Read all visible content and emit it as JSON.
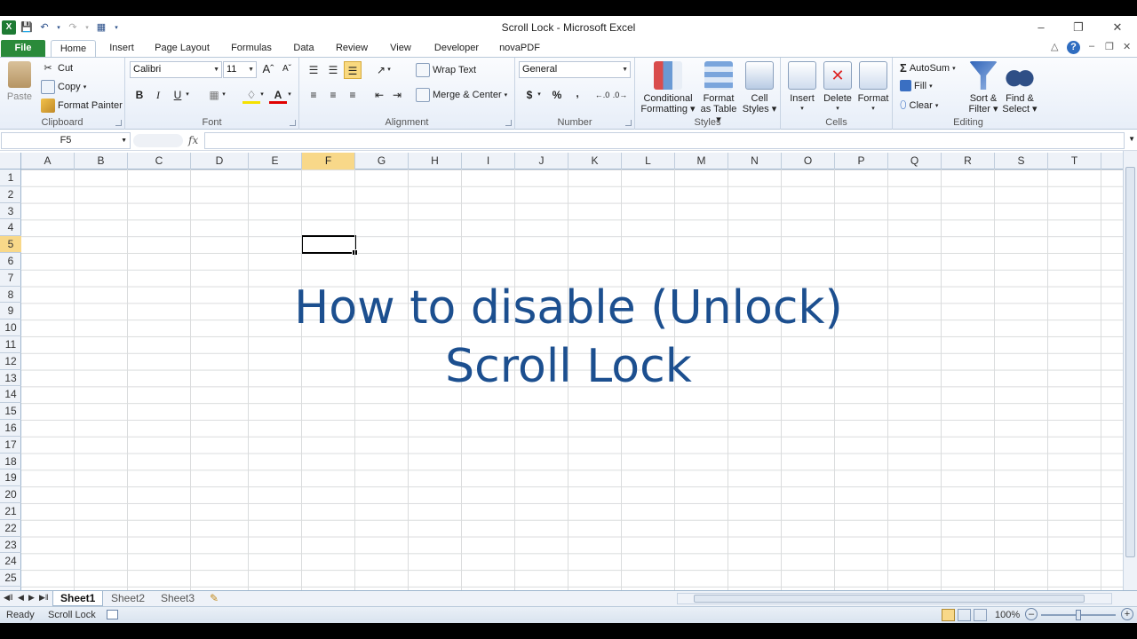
{
  "window": {
    "title": "Scroll Lock  -  Microsoft Excel"
  },
  "tabs": [
    "File",
    "Home",
    "Insert",
    "Page Layout",
    "Formulas",
    "Data",
    "Review",
    "View",
    "Developer",
    "novaPDF"
  ],
  "clipboard": {
    "paste": "Paste",
    "cut": "Cut",
    "copy": "Copy",
    "format_painter": "Format Painter",
    "label": "Clipboard"
  },
  "font": {
    "name": "Calibri",
    "size": "11",
    "bold": "B",
    "italic": "I",
    "underline": "U",
    "label": "Font"
  },
  "alignment": {
    "wrap": "Wrap Text",
    "merge": "Merge & Center",
    "label": "Alignment"
  },
  "number": {
    "format": "General",
    "currency": "$",
    "percent": "%",
    "comma": ",",
    "label": "Number"
  },
  "styles": {
    "conditional": "Conditional",
    "conditional2": "Formatting",
    "table": "Format",
    "table2": "as Table",
    "cell": "Cell",
    "cell2": "Styles",
    "label": "Styles"
  },
  "cells_group": {
    "insert": "Insert",
    "delete": "Delete",
    "format": "Format",
    "label": "Cells"
  },
  "editing": {
    "autosum": "AutoSum",
    "fill": "Fill",
    "clear": "Clear",
    "sort": "Sort &",
    "sort2": "Filter",
    "find": "Find &",
    "find2": "Select",
    "label": "Editing"
  },
  "namebox": "F5",
  "fx": "fx",
  "columns": [
    "A",
    "B",
    "C",
    "D",
    "E",
    "F",
    "G",
    "H",
    "I",
    "J",
    "K",
    "L",
    "M",
    "N",
    "O",
    "P",
    "Q",
    "R",
    "S",
    "T"
  ],
  "rows": [
    "1",
    "2",
    "3",
    "4",
    "5",
    "6",
    "7",
    "8",
    "9",
    "10",
    "11",
    "12",
    "13",
    "14",
    "15",
    "16",
    "17",
    "18",
    "19",
    "20",
    "21",
    "22",
    "23",
    "24",
    "25"
  ],
  "selected": {
    "column": "F",
    "row": "5"
  },
  "overlay": {
    "line1": "How to disable (Unlock)",
    "line2": "Scroll Lock"
  },
  "sheets": [
    "Sheet1",
    "Sheet2",
    "Sheet3"
  ],
  "status": {
    "ready": "Ready",
    "scroll_lock": "Scroll Lock",
    "zoom": "100%"
  },
  "colors": {
    "accent": "#1c4f8f",
    "file_tab": "#2a8a3a",
    "selection": "#f8d889"
  }
}
